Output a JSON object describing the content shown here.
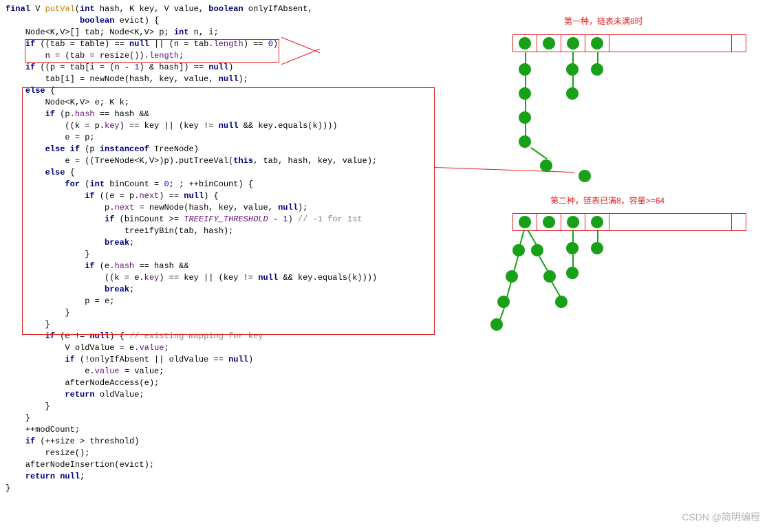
{
  "code": {
    "l1_final": "final",
    "l1_V": " V ",
    "l1_putVal": "putVal",
    "l1_sig1": "(",
    "l1_int": "int",
    "l1_hash": " hash, K key, V value, ",
    "l1_bool": "boolean",
    "l1_oia": " onlyIfAbsent,",
    "l2_bool": "boolean",
    "l2_evict": " evict) {",
    "l3a": "    Node<K,V>[] tab; Node<K,V> p; ",
    "l3_int": "int",
    "l3b": " n, i;",
    "l4a": "    ",
    "l4_if": "if",
    "l4b": " ((tab = table) == ",
    "l4_null": "null",
    "l4c": " || (n = tab.",
    "l4_len": "length",
    "l4d": ") == ",
    "l4_0": "0",
    "l4e": ")",
    "l5a": "        n = (tab = resize()).",
    "l5_len": "length",
    "l5b": ";",
    "l6a": "    ",
    "l6_if": "if",
    "l6b": " ((p = tab[i = (n - ",
    "l6_1": "1",
    "l6c": ") & hash]) == ",
    "l6_null": "null",
    "l6d": ")",
    "l7a": "        tab[i] = newNode(hash, key, value, ",
    "l7_null": "null",
    "l7b": ");",
    "l8a": "    ",
    "l8_else": "else",
    "l8b": " {",
    "l9": "        Node<K,V> e; K k;",
    "l10a": "        ",
    "l10_if": "if",
    "l10b": " (p.",
    "l10_hash": "hash",
    "l10c": " == hash &&",
    "l11a": "            ((k = p.",
    "l11_key": "key",
    "l11b": ") == key || (key != ",
    "l11_null": "null",
    "l11c": " && key.equals(k))))",
    "l12": "            e = p;",
    "l13a": "        ",
    "l13_elseif": "else if",
    "l13b": " (p ",
    "l13_inst": "instanceof",
    "l13c": " TreeNode)",
    "l14a": "            e = ((TreeNode<K,V>)p).putTreeVal(",
    "l14_this": "this",
    "l14b": ", tab, hash, key, value);",
    "l15a": "        ",
    "l15_else": "else",
    "l15b": " {",
    "l16a": "            ",
    "l16_for": "for",
    "l16b": " (",
    "l16_int": "int",
    "l16c": " binCount = ",
    "l16_0": "0",
    "l16d": "; ; ++binCount) {",
    "l17a": "                ",
    "l17_if": "if",
    "l17b": " ((e = p.",
    "l17_next": "next",
    "l17c": ") == ",
    "l17_null": "null",
    "l17d": ") {",
    "l18a": "                    p.",
    "l18_next": "next",
    "l18b": " = newNode(hash, key, value, ",
    "l18_null": "null",
    "l18c": ");",
    "l19a": "                    ",
    "l19_if": "if",
    "l19b": " (binCount >= ",
    "l19_cst": "TREEIFY_THRESHOLD",
    "l19c": " - ",
    "l19_1": "1",
    "l19d": ") ",
    "l19_cmt": "// -1 for 1st",
    "l20": "                        treeifyBin(tab, hash);",
    "l21a": "                    ",
    "l21_brk": "break",
    "l21b": ";",
    "l22": "                }",
    "l23a": "                ",
    "l23_if": "if",
    "l23b": " (e.",
    "l23_hash": "hash",
    "l23c": " == hash &&",
    "l24a": "                    ((k = e.",
    "l24_key": "key",
    "l24b": ") == key || (key != ",
    "l24_null": "null",
    "l24c": " && key.equals(k))))",
    "l25a": "                    ",
    "l25_brk": "break",
    "l25b": ";",
    "l26": "                p = e;",
    "l27": "            }",
    "l28": "        }",
    "l29a": "        ",
    "l29_if": "if",
    "l29b": " (e != ",
    "l29_null": "null",
    "l29c": ") { ",
    "l29_cmt": "// existing mapping for key",
    "l30a": "            V oldValue = e.",
    "l30_val": "value",
    "l30b": ";",
    "l31a": "            ",
    "l31_if": "if",
    "l31b": " (!onlyIfAbsent || oldValue == ",
    "l31_null": "null",
    "l31c": ")",
    "l32a": "                e.",
    "l32_val": "value",
    "l32b": " = value;",
    "l33": "            afterNodeAccess(e);",
    "l34a": "            ",
    "l34_ret": "return",
    "l34b": " oldValue;",
    "l35": "        }",
    "l36": "    }",
    "l37": "    ++modCount;",
    "l38a": "    ",
    "l38_if": "if",
    "l38b": " (++size > threshold)",
    "l39": "        resize();",
    "l40": "    afterNodeInsertion(evict);",
    "l41a": "    ",
    "l41_ret": "return null",
    "l41b": ";",
    "l42": "}"
  },
  "diagram": {
    "label1": "第一种，链表未满8时",
    "label2": "第二种，链表已满8，容量>=64"
  },
  "watermark": "CSDN @简明编程"
}
